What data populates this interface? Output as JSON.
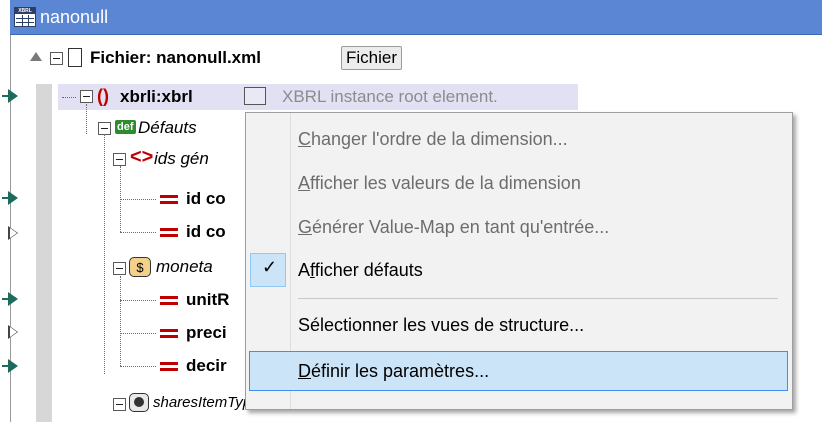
{
  "window": {
    "title": "nanonull",
    "title_icon_text": "XBRL"
  },
  "tree": {
    "file_label": "Fichier: nanonull.xml",
    "file_button": "Fichier",
    "root_element": "xbrli:xbrl",
    "root_annotation": "XBRL instance root element.",
    "defaults_badge": "def",
    "defaults_label": "Défauts",
    "ids_label": "ids gén",
    "id_item_1": "id co",
    "id_item_2": "id co",
    "monetary_label": "moneta",
    "monetary_icon": "$",
    "unit_item": "unitR",
    "precision_item": "preci",
    "decimals_item": "decir",
    "shares_label": "sharesItemType"
  },
  "menu": {
    "items": [
      {
        "label": "Changer l'ordre de la dimension...",
        "enabled": false,
        "mnemonic": "C"
      },
      {
        "label": "Afficher les valeurs de la dimension",
        "enabled": false,
        "mnemonic": "A"
      },
      {
        "label": "Générer Value-Map en tant qu'entrée...",
        "enabled": false,
        "mnemonic": "G"
      },
      {
        "label": "Afficher défauts",
        "enabled": true,
        "checked": true,
        "mnemonic": "f"
      },
      {
        "label": "Sélectionner les vues de structure...",
        "enabled": true
      },
      {
        "label": "Définir les paramètres...",
        "enabled": true,
        "hovered": true,
        "mnemonic": "D"
      }
    ],
    "check_glyph": "✓"
  },
  "colors": {
    "titlebar": "#5b86d4",
    "menu_highlight": "#cce4f7",
    "menu_highlight_border": "#3f8ef0",
    "element_red": "#c00000",
    "connector_green": "#1c6b5c"
  }
}
